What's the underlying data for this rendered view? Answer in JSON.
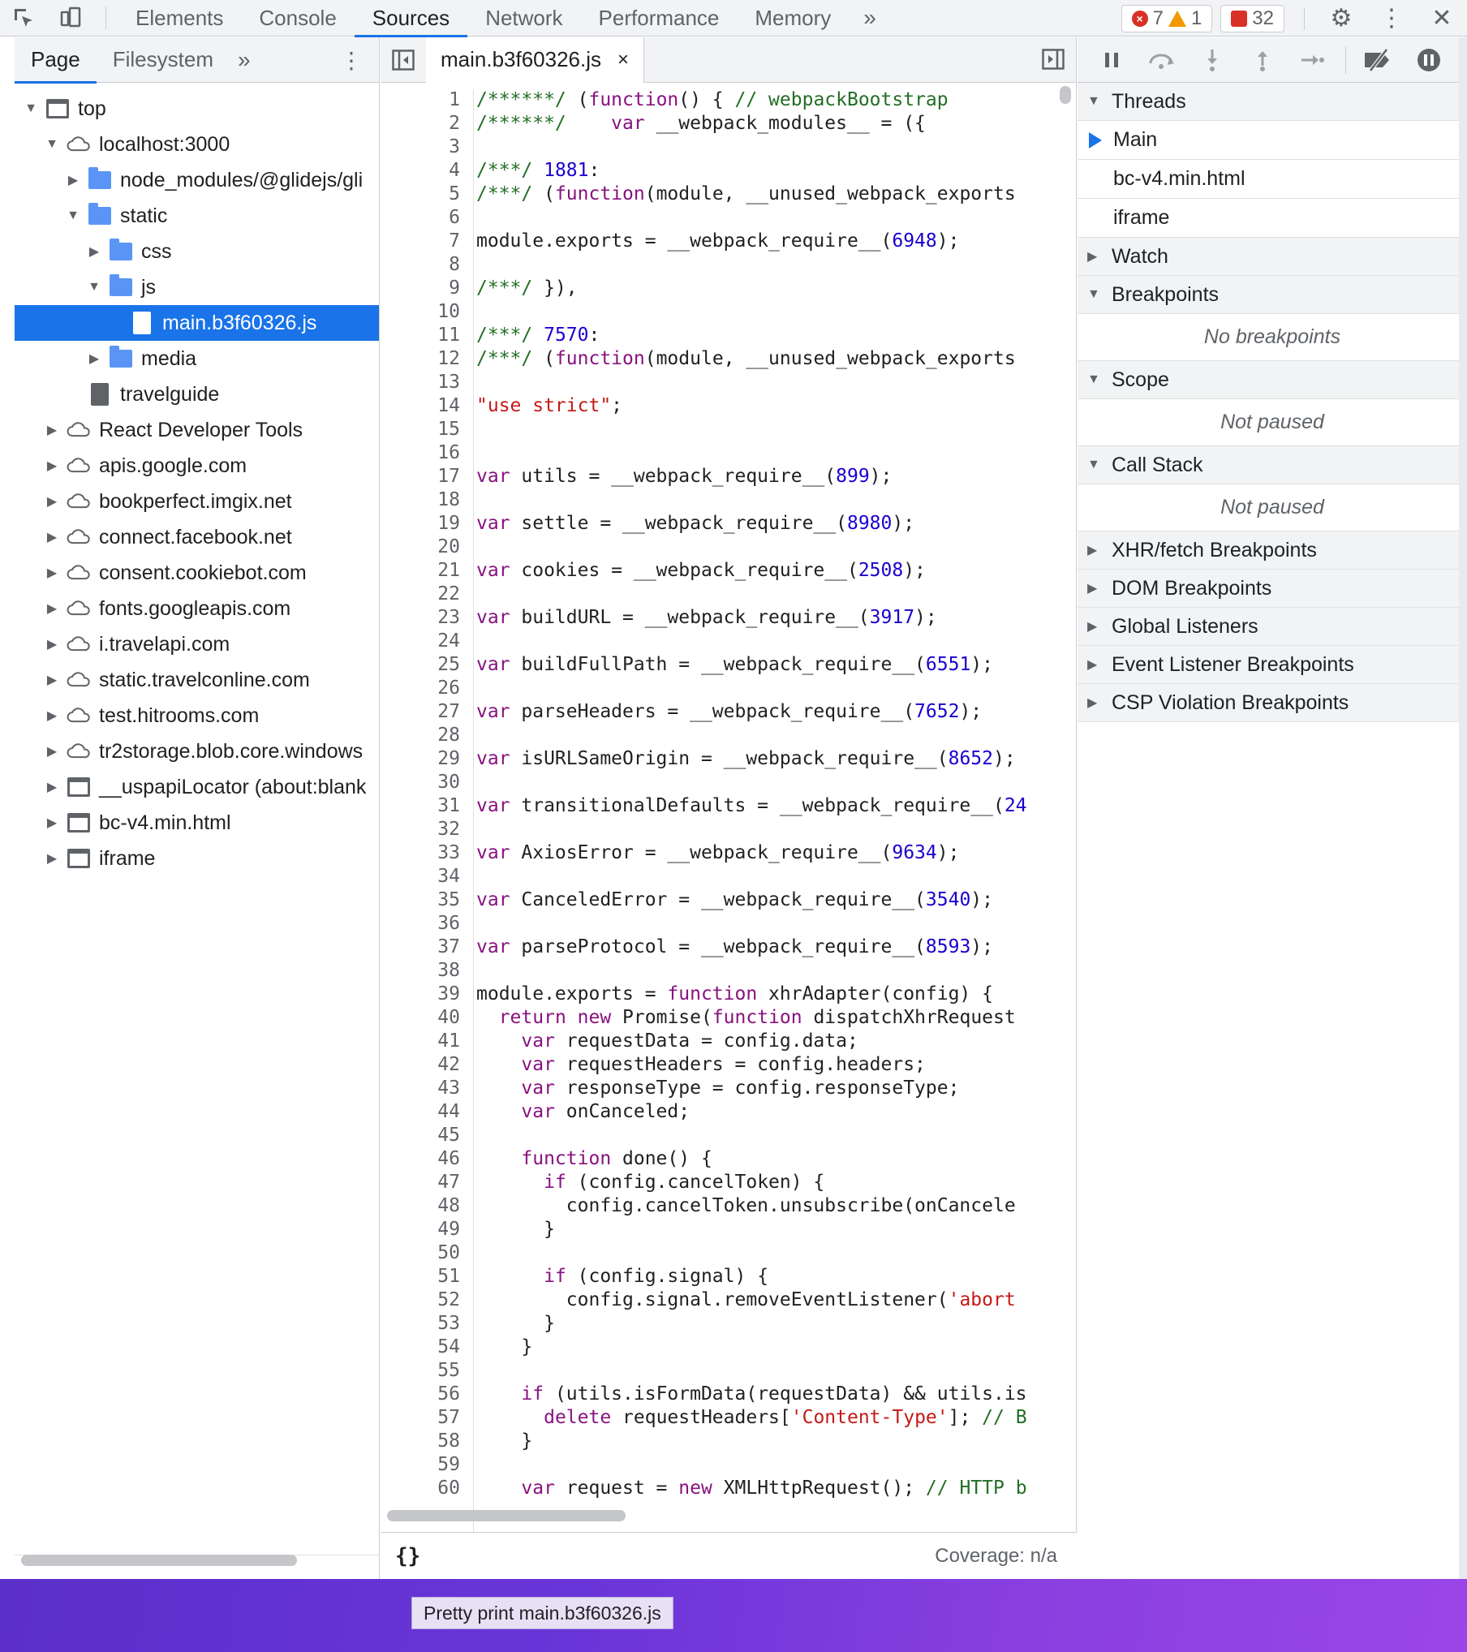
{
  "toolbar": {
    "tabs": [
      "Elements",
      "Console",
      "Sources",
      "Network",
      "Performance",
      "Memory"
    ],
    "active_tab": "Sources",
    "more": "»",
    "errors": "7",
    "warnings": "1",
    "issues": "32"
  },
  "navigator": {
    "tabs": [
      "Page",
      "Filesystem"
    ],
    "more": "»",
    "tree": [
      {
        "label": "top",
        "icon": "frame-icon",
        "expanded": true,
        "level": 0
      },
      {
        "label": "localhost:3000",
        "icon": "cloud-icon",
        "expanded": true,
        "level": 1
      },
      {
        "label": "node_modules/@glidejs/gli",
        "icon": "folder-icon",
        "expanded": false,
        "level": 2
      },
      {
        "label": "static",
        "icon": "folder-icon",
        "expanded": true,
        "level": 2
      },
      {
        "label": "css",
        "icon": "folder-icon",
        "expanded": false,
        "level": 3
      },
      {
        "label": "js",
        "icon": "folder-icon",
        "expanded": true,
        "level": 3
      },
      {
        "label": "main.b3f60326.js",
        "icon": "file-icon",
        "selected": true,
        "level": 4
      },
      {
        "label": "media",
        "icon": "folder-icon",
        "expanded": false,
        "level": 3
      },
      {
        "label": "travelguide",
        "icon": "document-icon",
        "level": 2
      },
      {
        "label": "React Developer Tools",
        "icon": "cloud-icon",
        "expanded": false,
        "level": 1
      },
      {
        "label": "apis.google.com",
        "icon": "cloud-icon",
        "expanded": false,
        "level": 1
      },
      {
        "label": "bookperfect.imgix.net",
        "icon": "cloud-icon",
        "expanded": false,
        "level": 1
      },
      {
        "label": "connect.facebook.net",
        "icon": "cloud-icon",
        "expanded": false,
        "level": 1
      },
      {
        "label": "consent.cookiebot.com",
        "icon": "cloud-icon",
        "expanded": false,
        "level": 1
      },
      {
        "label": "fonts.googleapis.com",
        "icon": "cloud-icon",
        "expanded": false,
        "level": 1
      },
      {
        "label": "i.travelapi.com",
        "icon": "cloud-icon",
        "expanded": false,
        "level": 1
      },
      {
        "label": "static.travelconline.com",
        "icon": "cloud-icon",
        "expanded": false,
        "level": 1
      },
      {
        "label": "test.hitrooms.com",
        "icon": "cloud-icon",
        "expanded": false,
        "level": 1
      },
      {
        "label": "tr2storage.blob.core.windows",
        "icon": "cloud-icon",
        "expanded": false,
        "level": 1
      },
      {
        "label": "__uspapiLocator (about:blank",
        "icon": "frame-icon",
        "expanded": false,
        "level": 1
      },
      {
        "label": "bc-v4.min.html",
        "icon": "frame-icon",
        "expanded": false,
        "level": 1
      },
      {
        "label": "iframe",
        "icon": "frame-icon",
        "expanded": false,
        "level": 1
      }
    ]
  },
  "editor": {
    "file_tab": "main.b3f60326.js",
    "close": "×",
    "pretty_print": "{}",
    "coverage": "Coverage: n/a",
    "lines": [
      "/******/ (function() { // webpackBootstrap",
      "/******/    var __webpack_modules__ = ({",
      "",
      "/***/ 1881:",
      "/***/ (function(module, __unused_webpack_exports",
      "",
      "module.exports = __webpack_require__(6948);",
      "",
      "/***/ }),",
      "",
      "/***/ 7570:",
      "/***/ (function(module, __unused_webpack_exports",
      "",
      "\"use strict\";",
      "",
      "",
      "var utils = __webpack_require__(899);",
      "",
      "var settle = __webpack_require__(8980);",
      "",
      "var cookies = __webpack_require__(2508);",
      "",
      "var buildURL = __webpack_require__(3917);",
      "",
      "var buildFullPath = __webpack_require__(6551);",
      "",
      "var parseHeaders = __webpack_require__(7652);",
      "",
      "var isURLSameOrigin = __webpack_require__(8652);",
      "",
      "var transitionalDefaults = __webpack_require__(24",
      "",
      "var AxiosError = __webpack_require__(9634);",
      "",
      "var CanceledError = __webpack_require__(3540);",
      "",
      "var parseProtocol = __webpack_require__(8593);",
      "",
      "module.exports = function xhrAdapter(config) {",
      "  return new Promise(function dispatchXhrRequest",
      "    var requestData = config.data;",
      "    var requestHeaders = config.headers;",
      "    var responseType = config.responseType;",
      "    var onCanceled;",
      "",
      "    function done() {",
      "      if (config.cancelToken) {",
      "        config.cancelToken.unsubscribe(onCancele",
      "      }",
      "",
      "      if (config.signal) {",
      "        config.signal.removeEventListener('abort",
      "      }",
      "    }",
      "",
      "    if (utils.isFormData(requestData) && utils.is",
      "      delete requestHeaders['Content-Type']; // B",
      "    }",
      "",
      "    var request = new XMLHttpRequest(); // HTTP b"
    ]
  },
  "debugger": {
    "threads_label": "Threads",
    "threads": [
      "Main",
      "bc-v4.min.html",
      "iframe"
    ],
    "watch_label": "Watch",
    "breakpoints_label": "Breakpoints",
    "no_breakpoints": "No breakpoints",
    "scope_label": "Scope",
    "scope_msg": "Not paused",
    "callstack_label": "Call Stack",
    "callstack_msg": "Not paused",
    "xhr_label": "XHR/fetch Breakpoints",
    "dom_label": "DOM Breakpoints",
    "global_label": "Global Listeners",
    "event_label": "Event Listener Breakpoints",
    "csp_label": "CSP Violation Breakpoints"
  },
  "tooltip": "Pretty print main.b3f60326.js"
}
